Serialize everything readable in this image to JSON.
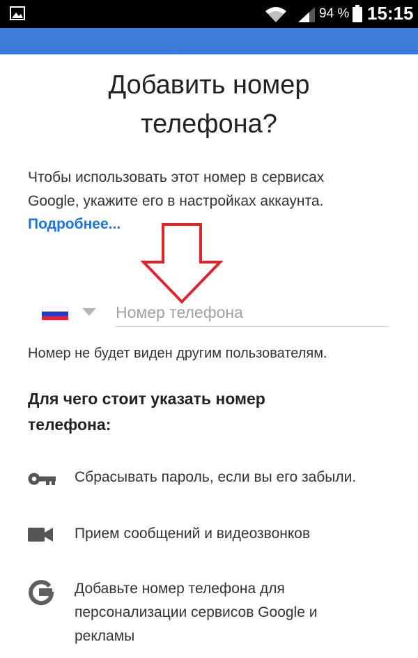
{
  "status_bar": {
    "battery_percent": "94 %",
    "time": "15:15",
    "icons": [
      "image-icon",
      "wifi-icon",
      "signal-icon",
      "battery-icon"
    ]
  },
  "header": {
    "title_line1": "Добавить номер",
    "title_line2": "телефона?"
  },
  "description": {
    "line1": "Чтобы использовать этот номер в сервисах",
    "line2": "Google, укажите его в настройках аккаунта.",
    "learn_more": "Подробнее..."
  },
  "phone_field": {
    "country": "RU",
    "value": "",
    "placeholder": "Номер телефона"
  },
  "note": "Номер не будет виден другим пользователям.",
  "why_heading": {
    "line1": "Для чего стоит указать номер",
    "line2": "телефона:"
  },
  "benefits": [
    {
      "icon": "key-icon",
      "text": "Сбрасывать пароль, если вы его забыли."
    },
    {
      "icon": "video-camera-icon",
      "text": "Прием сообщений и видеозвонков"
    },
    {
      "icon": "google-icon",
      "line1": "Добавьте номер телефона для",
      "line2": "персонализации сервисов Google и",
      "line3": "рекламы"
    }
  ],
  "colors": {
    "accent": "#3a78d6",
    "link": "#1a73e8",
    "annotation_arrow": "#e0262b"
  }
}
